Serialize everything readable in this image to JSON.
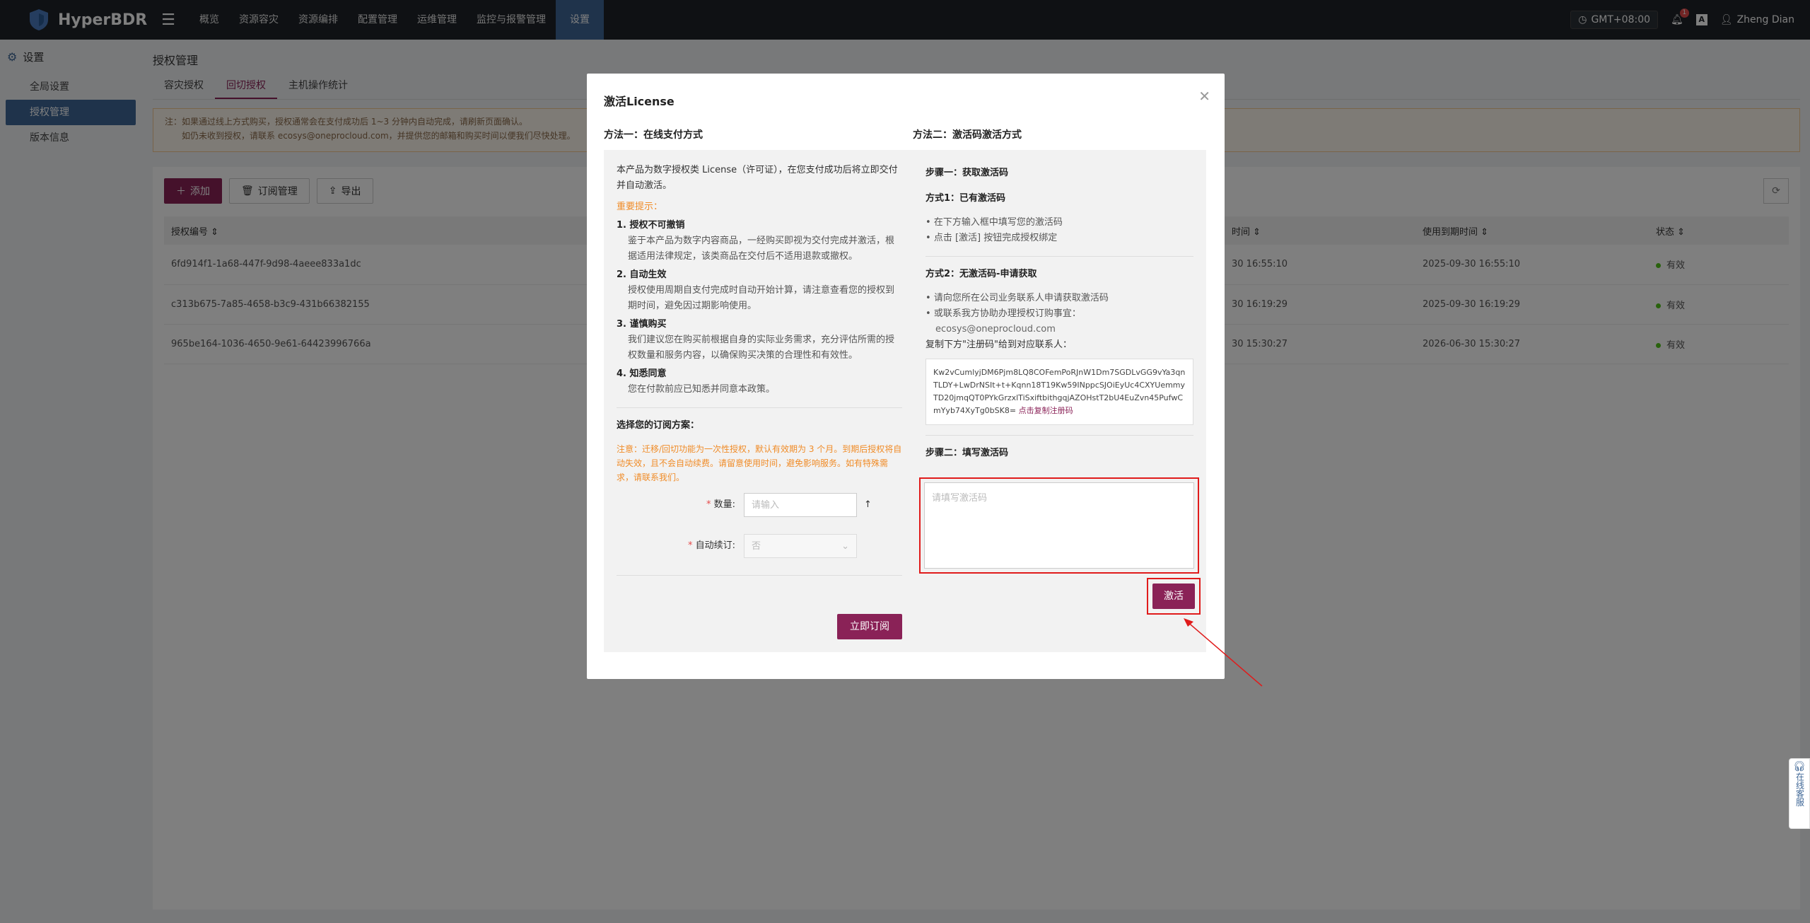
{
  "topbar": {
    "logo_text": "HyperBDR",
    "nav": [
      "概览",
      "资源容灾",
      "资源编排",
      "配置管理",
      "运维管理",
      "监控与报警管理",
      "设置"
    ],
    "timezone": "GMT+08:00",
    "bell_count": "1",
    "lang_icon": "A",
    "user": "Zheng Dian"
  },
  "sidebar": {
    "header": "设置",
    "items": [
      "全局设置",
      "授权管理",
      "版本信息"
    ]
  },
  "main": {
    "title": "授权管理",
    "tabs": [
      "容灾授权",
      "回切授权",
      "主机操作统计"
    ],
    "notice_line1": "注：如果通过线上方式购买，授权通常会在支付成功后 1~3 分钟内自动完成，请刷新页面确认。",
    "notice_line2": "如仍未收到授权，请联系 ecosys@oneprocloud.com，并提供您的邮箱和购买时间以便我们尽快处理。",
    "toolbar": {
      "add": "添加",
      "subscribe": "订阅管理",
      "export": "导出"
    },
    "table": {
      "headers": [
        "授权编号",
        "时间",
        "使用到期时间",
        "状态"
      ],
      "rows": [
        {
          "id": "6fd914f1-1a68-447f-9d98-4aeee833a1dc",
          "time": "30 16:55:10",
          "expire": "2025-09-30 16:55:10",
          "status": "有效"
        },
        {
          "id": "c313b675-7a85-4658-b3c9-431b66382155",
          "time": "30 16:19:29",
          "expire": "2025-09-30 16:19:29",
          "status": "有效"
        },
        {
          "id": "965be164-1036-4650-9e61-64423996766a",
          "time": "30 15:30:27",
          "expire": "2026-06-30 15:30:27",
          "status": "有效"
        }
      ]
    }
  },
  "modal": {
    "title": "激活License",
    "left_title": "方法一：在线支付方式",
    "left_intro": "本产品为数字授权类 License（许可证），在您支付成功后将立即交付并自动激活。",
    "important": "重要提示：",
    "points": [
      {
        "head": "1. 授权不可撤销",
        "body": "鉴于本产品为数字内容商品，一经购买即视为交付完成并激活，根据适用法律规定，该类商品在交付后不适用退款或撤权。"
      },
      {
        "head": "2. 自动生效",
        "body": "授权使用周期自支付完成时自动开始计算，请注意查看您的授权到期时间，避免因过期影响使用。"
      },
      {
        "head": "3. 谨慎购买",
        "body": "我们建议您在购买前根据自身的实际业务需求，充分评估所需的授权数量和服务内容，以确保购买决策的合理性和有效性。"
      },
      {
        "head": "4. 知悉同意",
        "body": "您在付款前应已知悉并同意本政策。"
      }
    ],
    "plan_title": "选择您的订阅方案：",
    "plan_note": "注意：迁移/回切功能为一次性授权，默认有效期为 3 个月。到期后授权将自动失效，且不会自动续费。请留意使用时间，避免影响服务。如有特殊需求，请联系我们。",
    "qty_label": "数量:",
    "qty_placeholder": "请输入",
    "renew_label": "自动续订:",
    "renew_value": "否",
    "subscribe_btn": "立即订阅",
    "right_title": "方法二：激活码激活方式",
    "step1": "步骤一：获取激活码",
    "way1": "方式1：已有激活码",
    "way1_items": [
      "在下方输入框中填写您的激活码",
      "点击 [激活] 按钮完成授权绑定"
    ],
    "way2": "方式2：无激活码-申请获取",
    "way2_items": [
      "请向您所在公司业务联系人申请获取激活码",
      "或联系我方协助办理授权订购事宜："
    ],
    "contact": "ecosys@oneprocloud.com",
    "copy_label": "复制下方\"注册码\"给到对应联系人：",
    "reg_code": "Kw2vCumlyjDM6Pjm8LQ8COFemPoRJnW1Dm7SGDLvGG9vYa3qnTLDY+LwDrNSIt+t+Kqnn18T19Kw59INppcSJOiEyUc4CXYUemmyTD20jmqQT0PYkGrzxlTiSxiftbithgqjAZOHstT2bU4EuZvn45PufwCmYyb74XyTg0bSK8=",
    "copy_link": "点击复制注册码",
    "step2": "步骤二：填写激活码",
    "code_placeholder": "请填写激活码",
    "activate_btn": "激活"
  },
  "float_service": "在线客服"
}
